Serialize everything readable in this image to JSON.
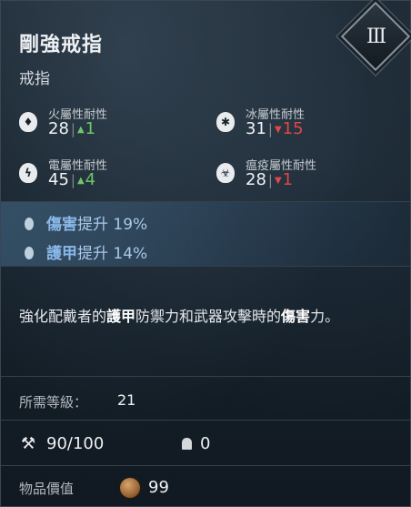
{
  "item": {
    "name": "剛強戒指",
    "type": "戒指",
    "tier": "III"
  },
  "resistances": [
    {
      "label": "火屬性耐性",
      "icon": "fire-icon",
      "glyph": "♦",
      "base": "28",
      "change": "1",
      "direction": "up"
    },
    {
      "label": "冰屬性耐性",
      "icon": "snowflake-icon",
      "glyph": "✱",
      "base": "31",
      "change": "15",
      "direction": "down"
    },
    {
      "label": "電屬性耐性",
      "icon": "lightning-icon",
      "glyph": "ϟ",
      "base": "45",
      "change": "4",
      "direction": "up"
    },
    {
      "label": "瘟疫屬性耐性",
      "icon": "plague-icon",
      "glyph": "☣",
      "base": "28",
      "change": "1",
      "direction": "down"
    }
  ],
  "bonuses": [
    {
      "stat": "傷害",
      "text": "提升 19%"
    },
    {
      "stat": "護甲",
      "text": "提升 14%"
    }
  ],
  "description": {
    "p1": "強化配戴者的",
    "k1": "護甲",
    "p2": "防禦力和武器攻擊時的",
    "k2": "傷害",
    "p3": "力。"
  },
  "requirement": {
    "label": "所需等級：",
    "value": "21"
  },
  "durability": "90/100",
  "upgrades": "0",
  "value": {
    "label": "物品價值",
    "amount": "99"
  },
  "colors": {
    "bonus_key": "#8ab8e8",
    "increase": "#6fc66a",
    "decrease": "#e24646"
  }
}
